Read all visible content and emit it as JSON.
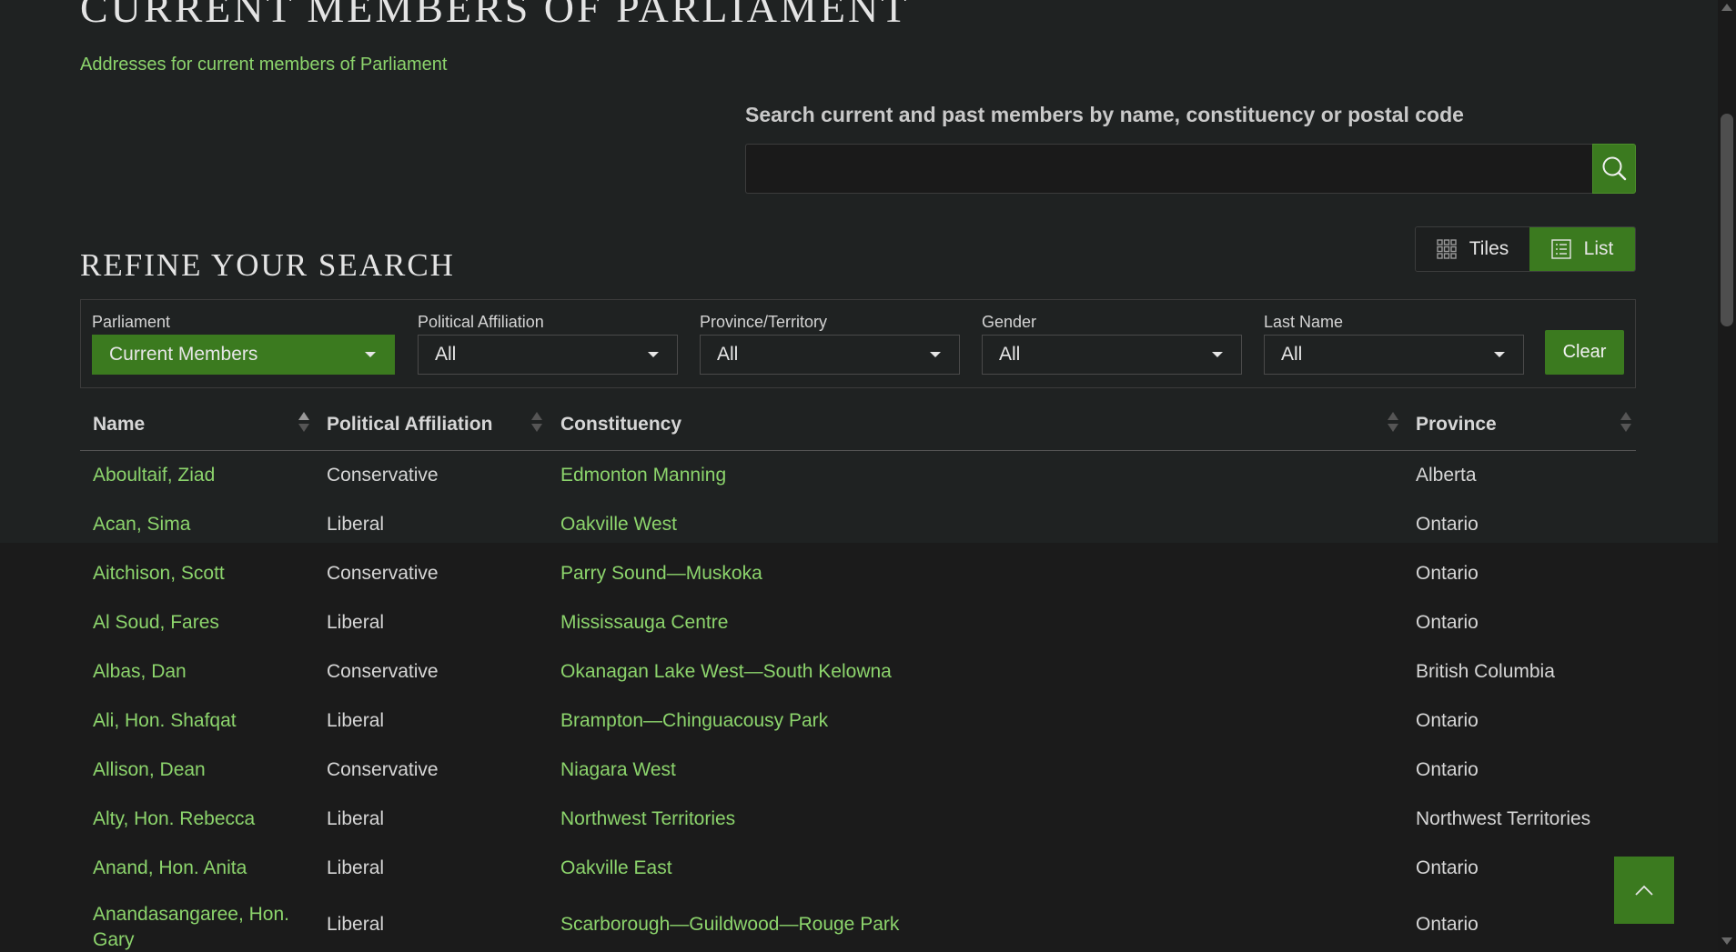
{
  "header": {
    "title": "Current Members of Parliament",
    "addresses_link": "Addresses for current members of Parliament"
  },
  "search": {
    "label": "Search current and past members by name, constituency or postal code",
    "value": "",
    "button_icon": "search-icon"
  },
  "view_toggle": {
    "tiles_label": "Tiles",
    "list_label": "List",
    "selected": "List"
  },
  "refine": {
    "title": "Refine Your Search",
    "filters": [
      {
        "label": "Parliament",
        "value": "Current Members"
      },
      {
        "label": "Political Affiliation",
        "value": "All"
      },
      {
        "label": "Province/Territory",
        "value": "All"
      },
      {
        "label": "Gender",
        "value": "All"
      },
      {
        "label": "Last Name",
        "value": "All"
      }
    ],
    "clear_label": "Clear"
  },
  "table": {
    "columns": [
      "Name",
      "Political Affiliation",
      "Constituency",
      "Province"
    ],
    "rows": [
      {
        "name": "Aboultaif, Ziad",
        "party": "Conservative",
        "constituency": "Edmonton Manning",
        "province": "Alberta"
      },
      {
        "name": "Acan, Sima",
        "party": "Liberal",
        "constituency": "Oakville West",
        "province": "Ontario"
      },
      {
        "name": "Aitchison, Scott",
        "party": "Conservative",
        "constituency": "Parry Sound—Muskoka",
        "province": "Ontario"
      },
      {
        "name": "Al Soud, Fares",
        "party": "Liberal",
        "constituency": "Mississauga Centre",
        "province": "Ontario"
      },
      {
        "name": "Albas, Dan",
        "party": "Conservative",
        "constituency": "Okanagan Lake West—South Kelowna",
        "province": "British Columbia"
      },
      {
        "name": "Ali, Hon. Shafqat",
        "party": "Liberal",
        "constituency": "Brampton—Chinguacousy Park",
        "province": "Ontario"
      },
      {
        "name": "Allison, Dean",
        "party": "Conservative",
        "constituency": "Niagara West",
        "province": "Ontario"
      },
      {
        "name": "Alty, Hon. Rebecca",
        "party": "Liberal",
        "constituency": "Northwest Territories",
        "province": "Northwest Territories"
      },
      {
        "name": "Anand, Hon. Anita",
        "party": "Liberal",
        "constituency": "Oakville East",
        "province": "Ontario"
      },
      {
        "name": "Anandasangaree, Hon. Gary",
        "party": "Liberal",
        "constituency": "Scarborough—Guildwood—Rouge Park",
        "province": "Ontario"
      }
    ]
  },
  "colors": {
    "accent": "#3b7a1f",
    "link": "#8cd46c",
    "background": "#1f2222"
  }
}
